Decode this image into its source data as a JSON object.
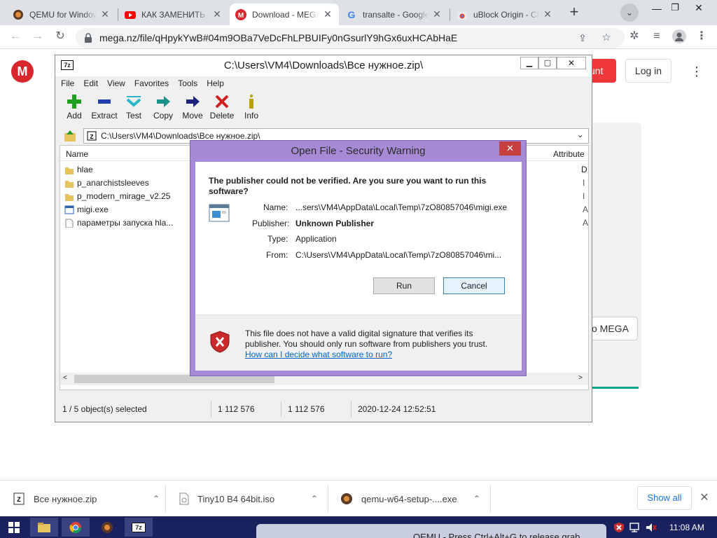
{
  "browser": {
    "tabs": [
      {
        "title": "QEMU for Windows",
        "icon": "qemu-icon"
      },
      {
        "title": "КАК ЗАМЕНИТЬ",
        "icon": "youtube-icon"
      },
      {
        "title": "Download - MEGA",
        "icon": "mega-icon"
      },
      {
        "title": "transalte - Google",
        "icon": "google-icon"
      },
      {
        "title": "uBlock Origin - Chrome",
        "icon": "chrome-webstore-icon"
      }
    ],
    "active_tab": 2,
    "new_tab": "+",
    "url": "mega.nz/file/qHpykYwB#04m9OBa7VeDcFhLPBUIFy0nGsurlY9hGx6uxHCAbHaE"
  },
  "mega": {
    "logo": "M",
    "account_button": "unt",
    "login_button": "Log in",
    "to_mega_button": "o MEGA"
  },
  "sevenzip": {
    "title": "C:\\Users\\VM4\\Downloads\\Все нужное.zip\\",
    "menu": [
      "File",
      "Edit",
      "View",
      "Favorites",
      "Tools",
      "Help"
    ],
    "tools": [
      "Add",
      "Extract",
      "Test",
      "Copy",
      "Move",
      "Delete",
      "Info"
    ],
    "address": "C:\\Users\\VM4\\Downloads\\Все нужное.zip\\",
    "columns": {
      "name": "Name",
      "attributes": "Attribute"
    },
    "files": [
      {
        "name": "hlae",
        "type": "folder",
        "attr": "D"
      },
      {
        "name": "p_anarchistsleeves",
        "type": "folder",
        "attr": "I"
      },
      {
        "name": "p_modern_mirage_v2.25",
        "type": "folder",
        "attr": "I"
      },
      {
        "name": "migi.exe",
        "type": "exe",
        "attr": "A"
      },
      {
        "name": "параметры запуска hla...",
        "type": "text",
        "attr": "A"
      }
    ],
    "status": {
      "selection": "1 / 5 object(s) selected",
      "size": "1 112 576",
      "packed": "1 112 576",
      "modified": "2020-12-24 12:52:51"
    }
  },
  "dialog": {
    "title": "Open File - Security Warning",
    "close": "✕",
    "question": "The publisher could not be verified.  Are you sure you want to run this software?",
    "fields": [
      {
        "label": "Name:",
        "value": "...sers\\VM4\\AppData\\Local\\Temp\\7zO80857046\\migi.exe"
      },
      {
        "label": "Publisher:",
        "value": "Unknown Publisher"
      },
      {
        "label": "Type:",
        "value": "Application"
      },
      {
        "label": "From:",
        "value": "C:\\Users\\VM4\\AppData\\Local\\Temp\\7zO80857046\\mi..."
      }
    ],
    "run": "Run",
    "cancel": "Cancel",
    "warning": "This file does not have a valid digital signature that verifies its publisher.  You should only run software from publishers you trust.",
    "link": "How can I decide what software to run?"
  },
  "downloads": {
    "items": [
      "Все нужное.zip",
      "Tiny10 B4 64bit.iso",
      "qemu-w64-setup-....exe"
    ],
    "show_all": "Show all",
    "close": "✕"
  },
  "taskbar": {
    "time": "11:08 AM",
    "qemu_hint": "QEMU - Press Ctrl+Alt+G to release grab"
  }
}
